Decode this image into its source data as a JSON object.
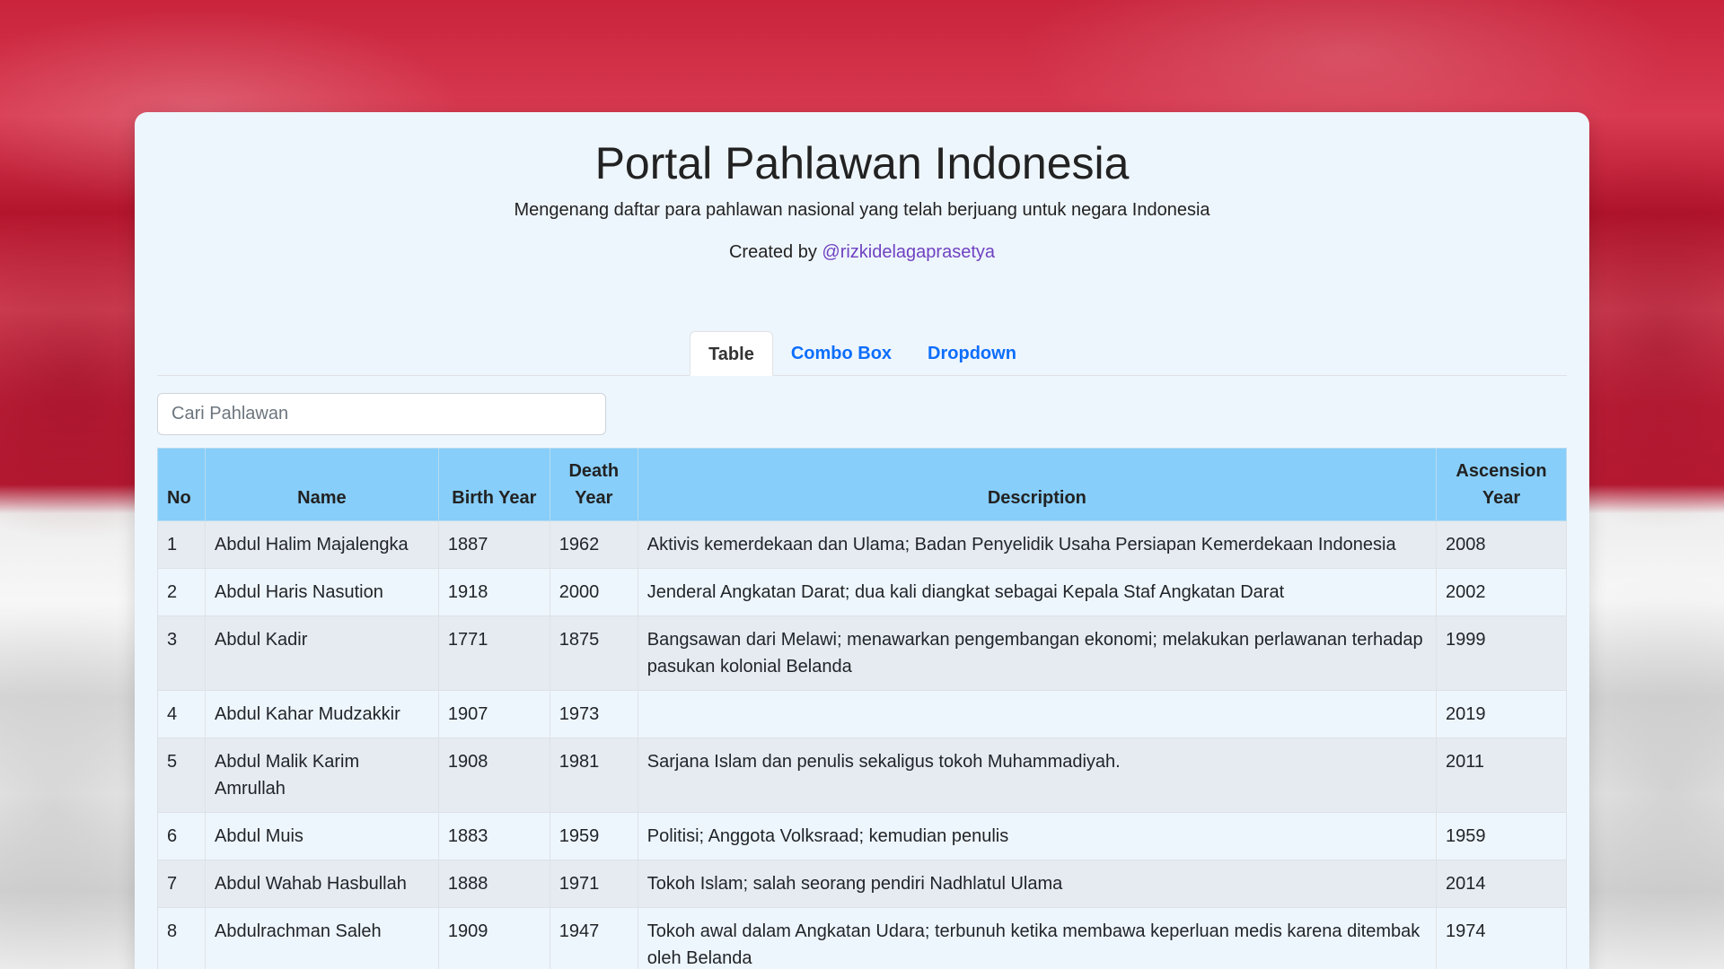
{
  "header": {
    "title": "Portal Pahlawan Indonesia",
    "subtitle": "Mengenang daftar para pahlawan nasional yang telah berjuang untuk negara Indonesia",
    "created_by_label": "Created by",
    "author_handle": "@rizkidelagaprasetya"
  },
  "tabs": [
    {
      "label": "Table",
      "active": true
    },
    {
      "label": "Combo Box",
      "active": false
    },
    {
      "label": "Dropdown",
      "active": false
    }
  ],
  "search": {
    "placeholder": "Cari Pahlawan",
    "value": ""
  },
  "table": {
    "columns": [
      "No",
      "Name",
      "Birth Year",
      "Death Year",
      "Description",
      "Ascension Year"
    ],
    "rows": [
      {
        "no": "1",
        "name": "Abdul Halim Majalengka",
        "birth": "1887",
        "death": "1962",
        "desc": "Aktivis kemerdekaan dan Ulama; Badan Penyelidik Usaha Persiapan Kemerdekaan Indonesia",
        "asc": "2008"
      },
      {
        "no": "2",
        "name": "Abdul Haris Nasution",
        "birth": "1918",
        "death": "2000",
        "desc": "Jenderal Angkatan Darat; dua kali diangkat sebagai Kepala Staf Angkatan Darat",
        "asc": "2002"
      },
      {
        "no": "3",
        "name": "Abdul Kadir",
        "birth": "1771",
        "death": "1875",
        "desc": "Bangsawan dari Melawi; menawarkan pengembangan ekonomi; melakukan perlawanan terhadap pasukan kolonial Belanda",
        "asc": "1999"
      },
      {
        "no": "4",
        "name": "Abdul Kahar Mudzakkir",
        "birth": "1907",
        "death": "1973",
        "desc": "",
        "asc": "2019"
      },
      {
        "no": "5",
        "name": "Abdul Malik Karim Amrullah",
        "birth": "1908",
        "death": "1981",
        "desc": "Sarjana Islam dan penulis sekaligus tokoh Muhammadiyah.",
        "asc": "2011"
      },
      {
        "no": "6",
        "name": "Abdul Muis",
        "birth": "1883",
        "death": "1959",
        "desc": "Politisi; Anggota Volksraad; kemudian penulis",
        "asc": "1959"
      },
      {
        "no": "7",
        "name": "Abdul Wahab Hasbullah",
        "birth": "1888",
        "death": "1971",
        "desc": "Tokoh Islam; salah seorang pendiri Nadhlatul Ulama",
        "asc": "2014"
      },
      {
        "no": "8",
        "name": "Abdulrachman Saleh",
        "birth": "1909",
        "death": "1947",
        "desc": "Tokoh awal dalam Angkatan Udara; terbunuh ketika membawa keperluan medis karena ditembak oleh Belanda",
        "asc": "1974"
      }
    ]
  },
  "colors": {
    "header_bg": "#87cefa",
    "card_bg": "#eef6fd",
    "link": "#0d6efd",
    "author_link": "#6f42c1"
  }
}
